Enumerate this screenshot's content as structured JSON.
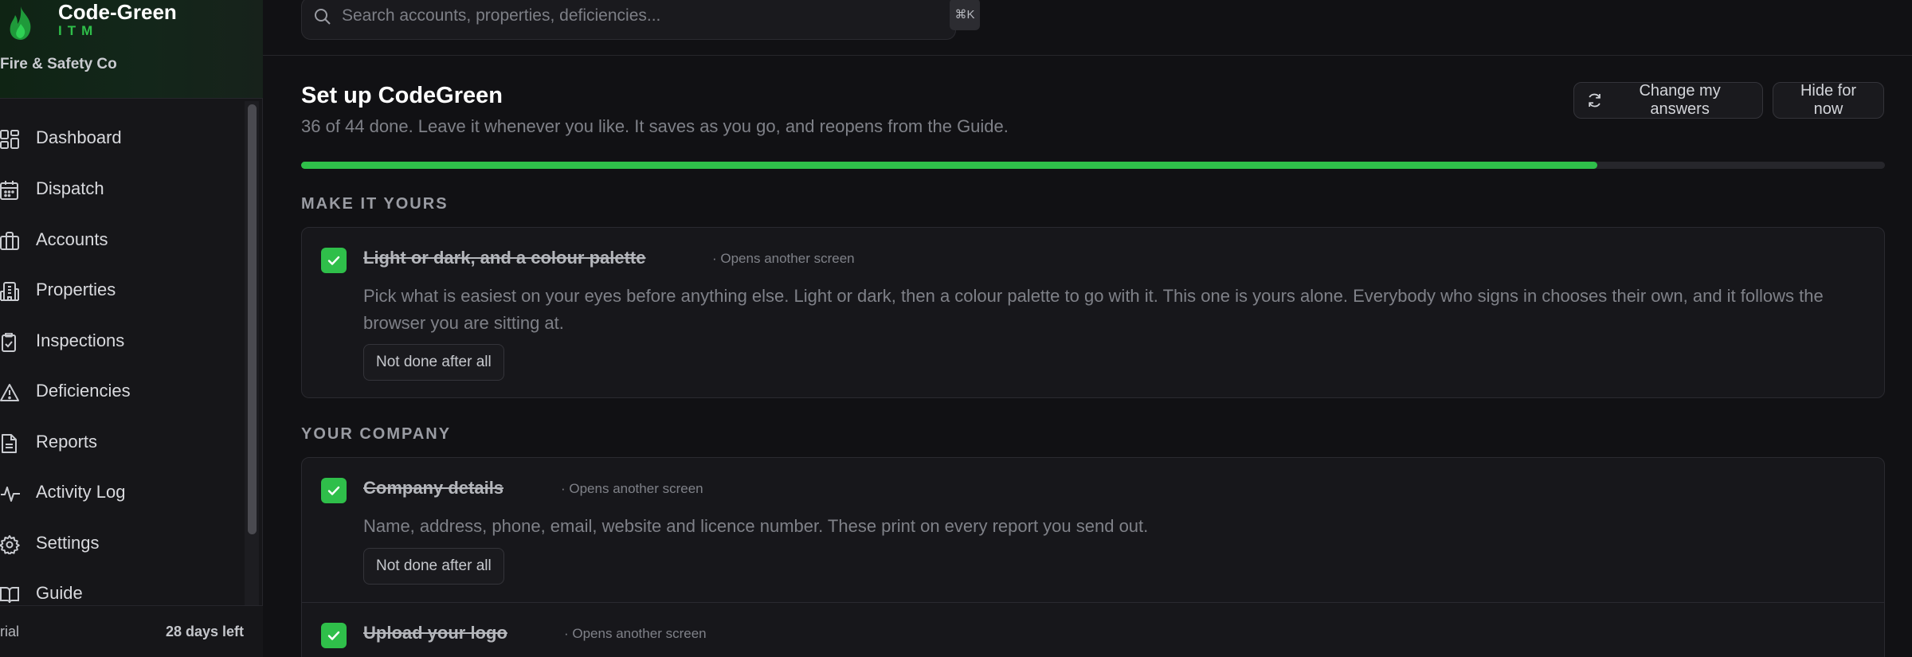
{
  "brand": {
    "name": "Code-Green",
    "sub": "ITM",
    "company": "Fire & Safety Co",
    "logo_icon": "flame-icon",
    "accent_color": "#2fbf4a"
  },
  "sidebar": {
    "items": [
      {
        "label": "Dashboard",
        "icon": "dashboard-grid-icon"
      },
      {
        "label": "Dispatch",
        "icon": "calendar-icon"
      },
      {
        "label": "Accounts",
        "icon": "briefcase-icon"
      },
      {
        "label": "Properties",
        "icon": "building-icon"
      },
      {
        "label": "Inspections",
        "icon": "clipboard-check-icon"
      },
      {
        "label": "Deficiencies",
        "icon": "warning-triangle-icon"
      },
      {
        "label": "Reports",
        "icon": "document-icon"
      },
      {
        "label": "Activity Log",
        "icon": "activity-pulse-icon"
      },
      {
        "label": "Settings",
        "icon": "gear-icon"
      },
      {
        "label": "Guide",
        "icon": "book-icon"
      }
    ],
    "trial": {
      "left": "rial",
      "right": "28 days left"
    }
  },
  "search": {
    "placeholder": "Search accounts, properties, deficiencies...",
    "shortcut": "⌘K"
  },
  "setup": {
    "title": "Set up CodeGreen",
    "subtitle": "36 of 44 done. Leave it whenever you like. It saves as you go, and reopens from the Guide.",
    "done": 36,
    "total": 44,
    "change_label": "Change my answers",
    "hide_label": "Hide for now"
  },
  "sections": [
    {
      "heading": "MAKE IT YOURS",
      "tasks": [
        {
          "title": "Light or dark, and a colour palette",
          "hint": "· Opens another screen",
          "description": "Pick what is easiest on your eyes before anything else. Light or dark, then a colour palette to go with it. This one is yours alone. Everybody who signs in chooses their own, and it follows the browser you are sitting at.",
          "undo_label": "Not done after all",
          "done": true
        }
      ]
    },
    {
      "heading": "YOUR COMPANY",
      "tasks": [
        {
          "title": "Company details",
          "hint": "· Opens another screen",
          "description": "Name, address, phone, email, website and licence number. These print on every report you send out.",
          "undo_label": "Not done after all",
          "done": true
        },
        {
          "title": "Upload your logo",
          "hint": "· Opens another screen",
          "done": true
        }
      ]
    }
  ]
}
